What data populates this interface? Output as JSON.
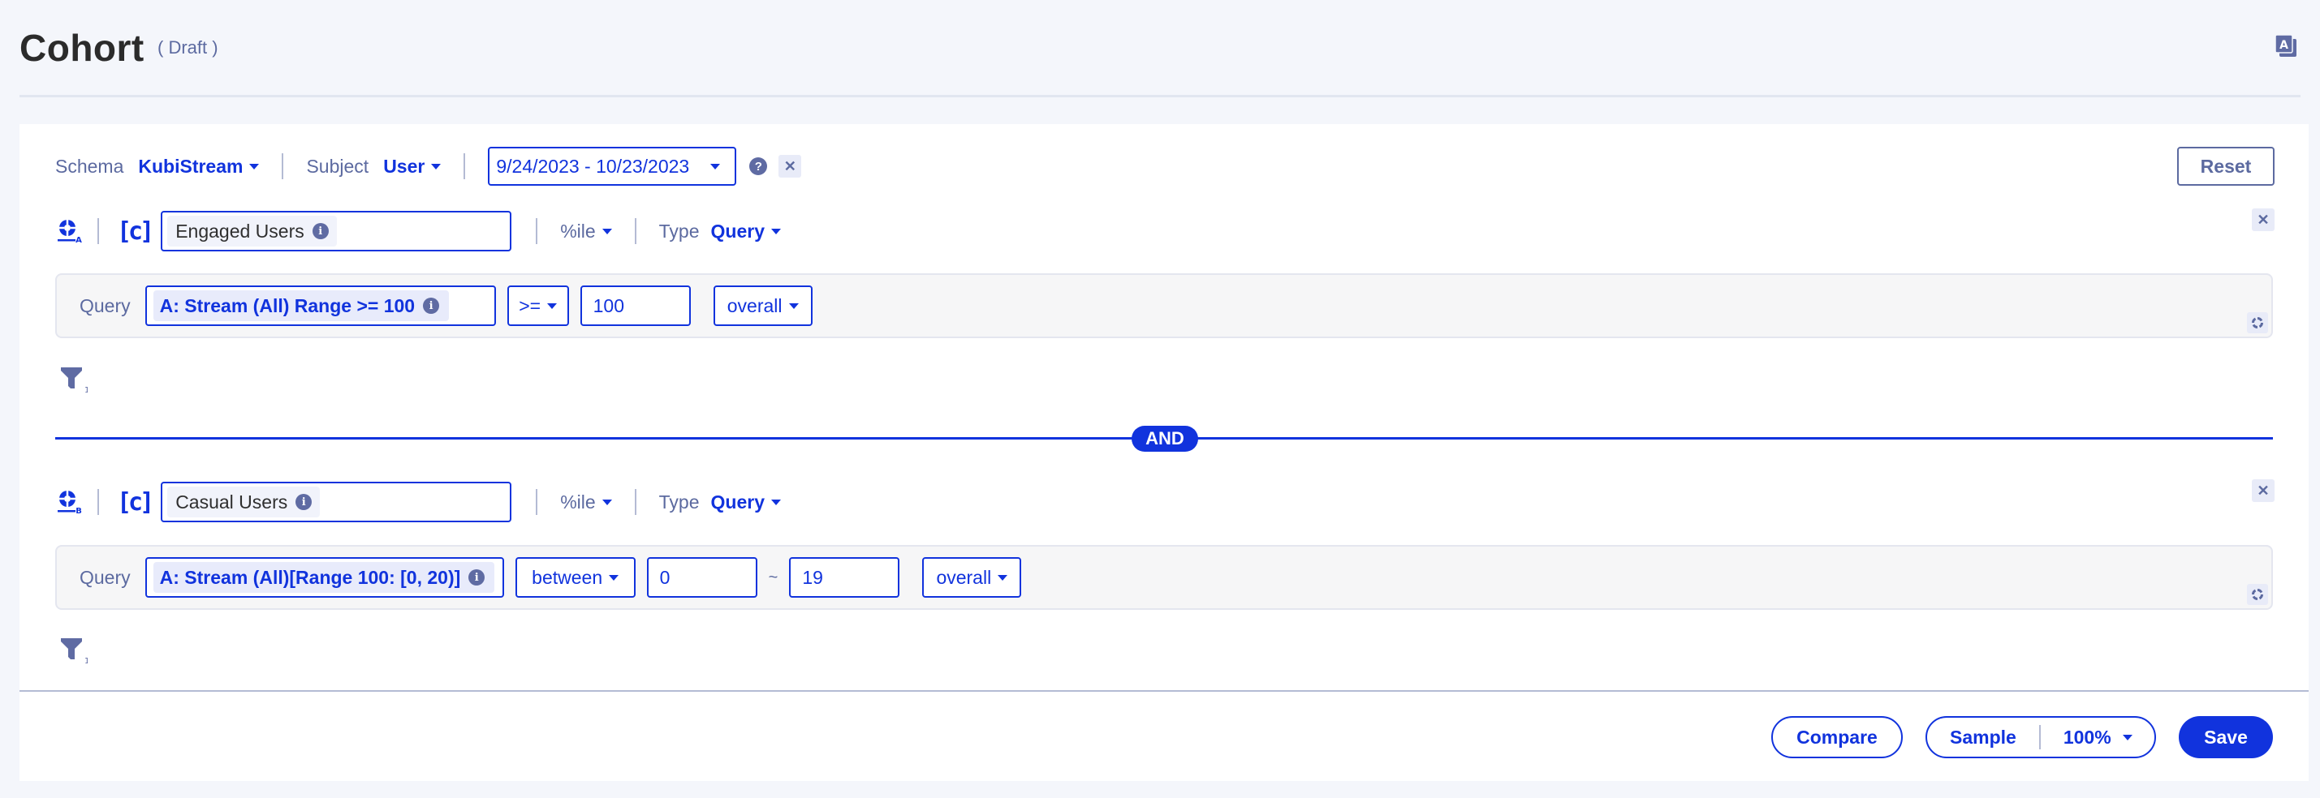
{
  "header": {
    "title": "Cohort",
    "status": "( Draft )",
    "icon": "translate-icon"
  },
  "toolbar": {
    "schema_label": "Schema",
    "schema_value": "KubiStream",
    "subject_label": "Subject",
    "subject_value": "User",
    "date_range": "9/24/2023 - 10/23/2023",
    "help_glyph": "?",
    "clear_glyph": "✕",
    "reset_label": "Reset"
  },
  "conditions": [
    {
      "letter": "A",
      "bracket_label": "[c]",
      "name": "Engaged Users",
      "metric": "%ile",
      "type_label": "Type",
      "type_value": "Query",
      "query_label": "Query",
      "query_value": "A: Stream (All) Range >= 100",
      "operator": ">=",
      "value": "100",
      "scope": "overall",
      "filter_count": "1"
    },
    {
      "letter": "B",
      "bracket_label": "[c]",
      "name": "Casual Users",
      "metric": "%ile",
      "type_label": "Type",
      "type_value": "Query",
      "query_label": "Query",
      "query_value": "A: Stream (All)[Range 100: [0, 20)]",
      "operator": "between",
      "value_from": "0",
      "range_sep": "~",
      "value_to": "19",
      "scope": "overall",
      "filter_count": "1"
    }
  ],
  "connector": "AND",
  "footer": {
    "compare_label": "Compare",
    "sample_label": "Sample",
    "sample_value": "100%",
    "save_label": "Save"
  },
  "colors": {
    "accent": "#1133dd",
    "muted": "#5c6aa0",
    "background": "#f4f6fb"
  }
}
